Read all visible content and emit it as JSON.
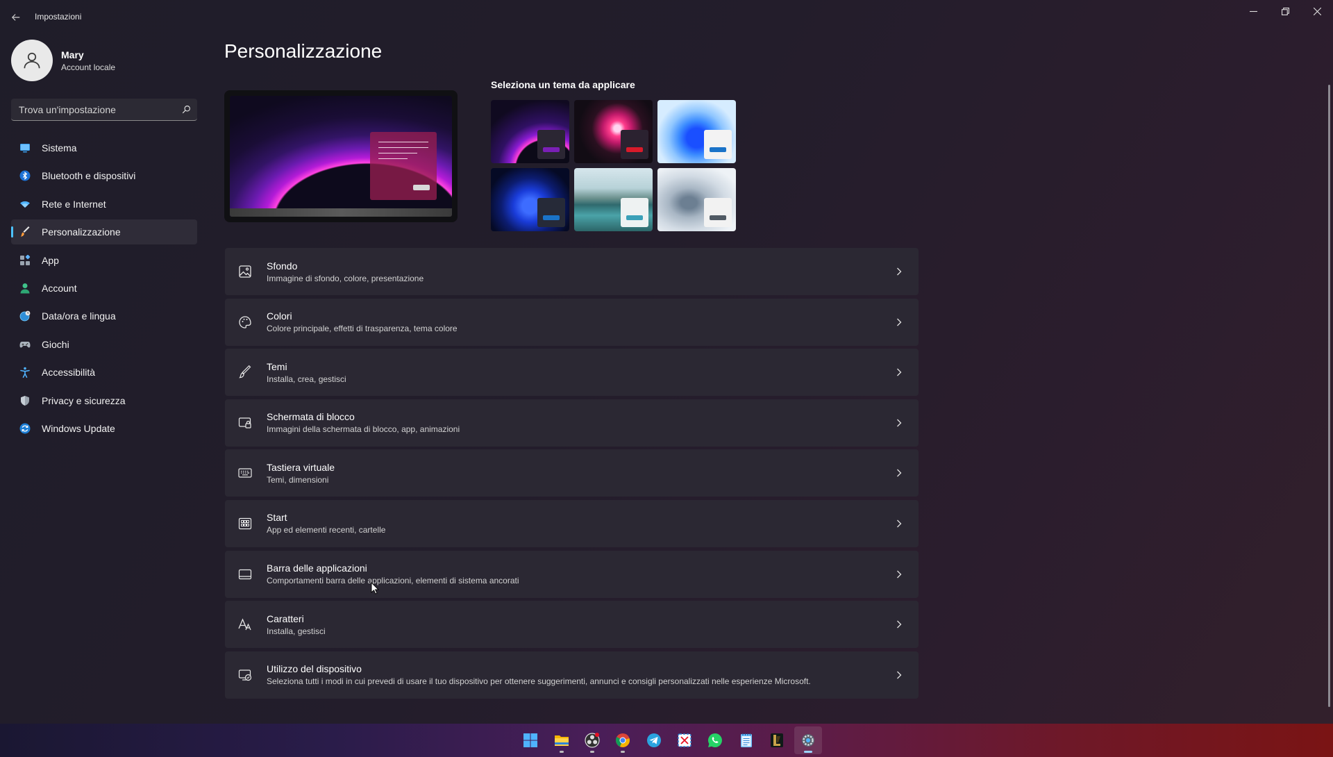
{
  "window": {
    "title": "Impostazioni",
    "back_label": "←",
    "minimize_label": "Minimize",
    "restore_label": "Restore",
    "close_label": "Close"
  },
  "user": {
    "name": "Mary",
    "account_type": "Account locale"
  },
  "search": {
    "placeholder": "Trova un'impostazione",
    "value": ""
  },
  "sidebar": {
    "items": [
      {
        "label": "Sistema",
        "icon": "monitor-icon",
        "active": false
      },
      {
        "label": "Bluetooth e dispositivi",
        "icon": "bluetooth-icon",
        "active": false
      },
      {
        "label": "Rete e Internet",
        "icon": "wifi-icon",
        "active": false
      },
      {
        "label": "Personalizzazione",
        "icon": "paintbrush-icon",
        "active": true
      },
      {
        "label": "App",
        "icon": "apps-icon",
        "active": false
      },
      {
        "label": "Account",
        "icon": "person-icon",
        "active": false
      },
      {
        "label": "Data/ora e lingua",
        "icon": "globe-clock-icon",
        "active": false
      },
      {
        "label": "Giochi",
        "icon": "gamepad-icon",
        "active": false
      },
      {
        "label": "Accessibilità",
        "icon": "accessibility-icon",
        "active": false
      },
      {
        "label": "Privacy e sicurezza",
        "icon": "shield-icon",
        "active": false
      },
      {
        "label": "Windows Update",
        "icon": "update-icon",
        "active": false
      }
    ]
  },
  "main": {
    "title": "Personalizzazione",
    "themes_label": "Seleziona un tema da applicare",
    "themes": [
      {
        "name": "theme-windows-dark-glow",
        "accent": "#7a1fb5"
      },
      {
        "name": "theme-flower-glow",
        "accent": "#d81a2a"
      },
      {
        "name": "theme-windows-light",
        "accent": "#1a73c8"
      },
      {
        "name": "theme-windows-dark-blue",
        "accent": "#1a73c8"
      },
      {
        "name": "theme-captured-motion",
        "accent": "#3aa0b8"
      },
      {
        "name": "theme-sunrise-silver",
        "accent": "#505a64"
      }
    ],
    "cards": [
      {
        "title": "Sfondo",
        "subtitle": "Immagine di sfondo, colore, presentazione",
        "icon": "picture-icon"
      },
      {
        "title": "Colori",
        "subtitle": "Colore principale, effetti di trasparenza, tema colore",
        "icon": "palette-icon"
      },
      {
        "title": "Temi",
        "subtitle": "Installa, crea, gestisci",
        "icon": "brush-icon"
      },
      {
        "title": "Schermata di blocco",
        "subtitle": "Immagini della schermata di blocco, app, animazioni",
        "icon": "lock-screen-icon"
      },
      {
        "title": "Tastiera virtuale",
        "subtitle": "Temi, dimensioni",
        "icon": "keyboard-icon"
      },
      {
        "title": "Start",
        "subtitle": "App ed elementi recenti, cartelle",
        "icon": "start-icon"
      },
      {
        "title": "Barra delle applicazioni",
        "subtitle": "Comportamenti barra delle applicazioni, elementi di sistema ancorati",
        "icon": "taskbar-icon"
      },
      {
        "title": "Caratteri",
        "subtitle": "Installa, gestisci",
        "icon": "fonts-icon"
      },
      {
        "title": "Utilizzo del dispositivo",
        "subtitle": "Seleziona tutti i modi in cui prevedi di usare il tuo dispositivo per ottenere suggerimenti, annunci e consigli personalizzati nelle esperienze Microsoft.",
        "icon": "device-usage-icon"
      }
    ]
  },
  "taskbar": {
    "apps": [
      {
        "name": "start-icon",
        "active": false,
        "running": false
      },
      {
        "name": "file-explorer-icon",
        "active": false,
        "running": true
      },
      {
        "name": "obs-icon",
        "active": false,
        "running": true
      },
      {
        "name": "chrome-icon",
        "active": false,
        "running": true
      },
      {
        "name": "telegram-icon",
        "active": false,
        "running": false
      },
      {
        "name": "snipping-tool-icon",
        "active": false,
        "running": false
      },
      {
        "name": "whatsapp-icon",
        "active": false,
        "running": false
      },
      {
        "name": "notepad-icon",
        "active": false,
        "running": false
      },
      {
        "name": "league-icon",
        "active": false,
        "running": false
      },
      {
        "name": "settings-icon",
        "active": true,
        "running": true
      }
    ]
  },
  "colors": {
    "accent": "#4cc2ff",
    "card_bg": "#2b2833",
    "sidebar_active_bg": "#2f2c38"
  }
}
